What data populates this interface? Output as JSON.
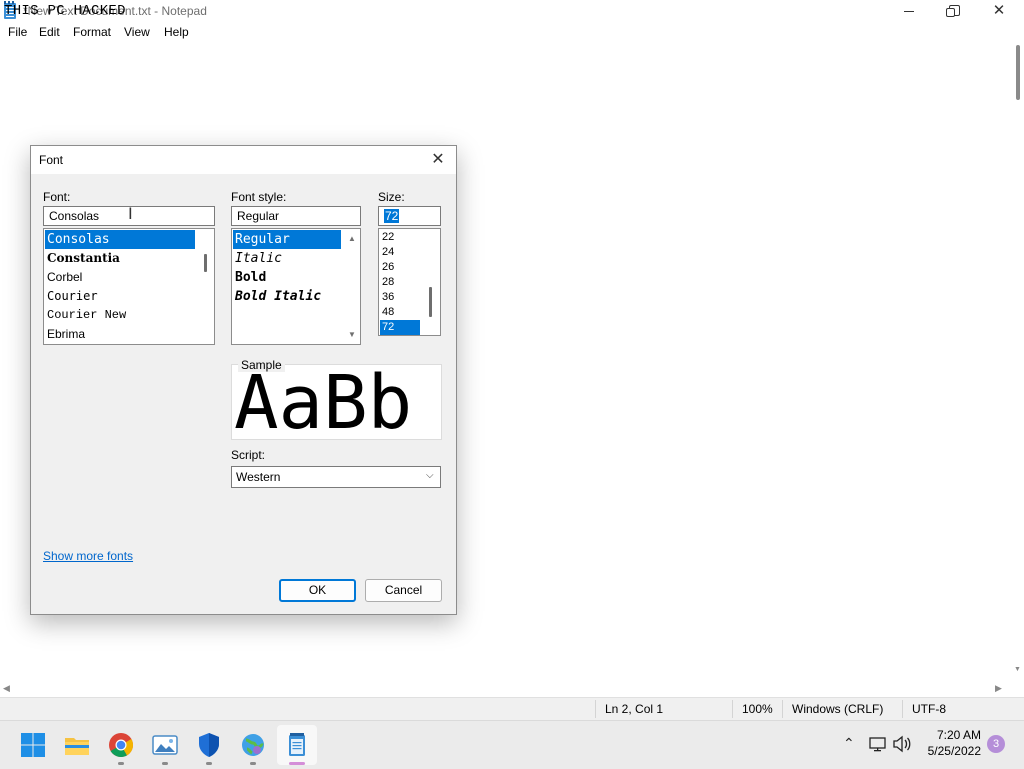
{
  "window": {
    "title": "*New Text Document.txt - Notepad",
    "controls": {
      "minimize": "—",
      "maximize": "❐",
      "close": "✕"
    }
  },
  "menu": [
    "File",
    "Edit",
    "Format",
    "View",
    "Help"
  ],
  "editor": {
    "text": "THIS PC HACKED"
  },
  "status": {
    "position": "Ln 2, Col 1",
    "zoom": "100%",
    "line_ending": "Windows (CRLF)",
    "encoding": "UTF-8"
  },
  "font_dialog": {
    "title": "Font",
    "font_label": "Font:",
    "font_value": "Consolas",
    "font_list": [
      "Consolas",
      "Constantia",
      "Corbel",
      "Courier",
      "Courier New",
      "Ebrima"
    ],
    "selected_font": "Consolas",
    "style_label": "Font style:",
    "style_value": "Regular",
    "style_list": [
      "Regular",
      "Italic",
      "Bold",
      "Bold Italic"
    ],
    "size_label": "Size:",
    "size_value": "72",
    "size_list": [
      "22",
      "24",
      "26",
      "28",
      "36",
      "48",
      "72"
    ],
    "sample_label": "Sample",
    "sample_text": "AaBb",
    "script_label": "Script:",
    "script_value": "Western",
    "show_more_fonts": "Show more fonts",
    "ok": "OK",
    "cancel": "Cancel"
  },
  "taskbar": {
    "apps": [
      "windows-start-icon",
      "file-explorer-icon",
      "chrome-icon",
      "photos-icon",
      "windows-security-icon",
      "network-globe-icon",
      "notepad-icon"
    ],
    "time": "7:20 AM",
    "date": "5/25/2022",
    "notification_count": "3"
  },
  "colors": {
    "selection": "#0078d7",
    "link": "#0066cc",
    "badge": "#b58ed8"
  }
}
